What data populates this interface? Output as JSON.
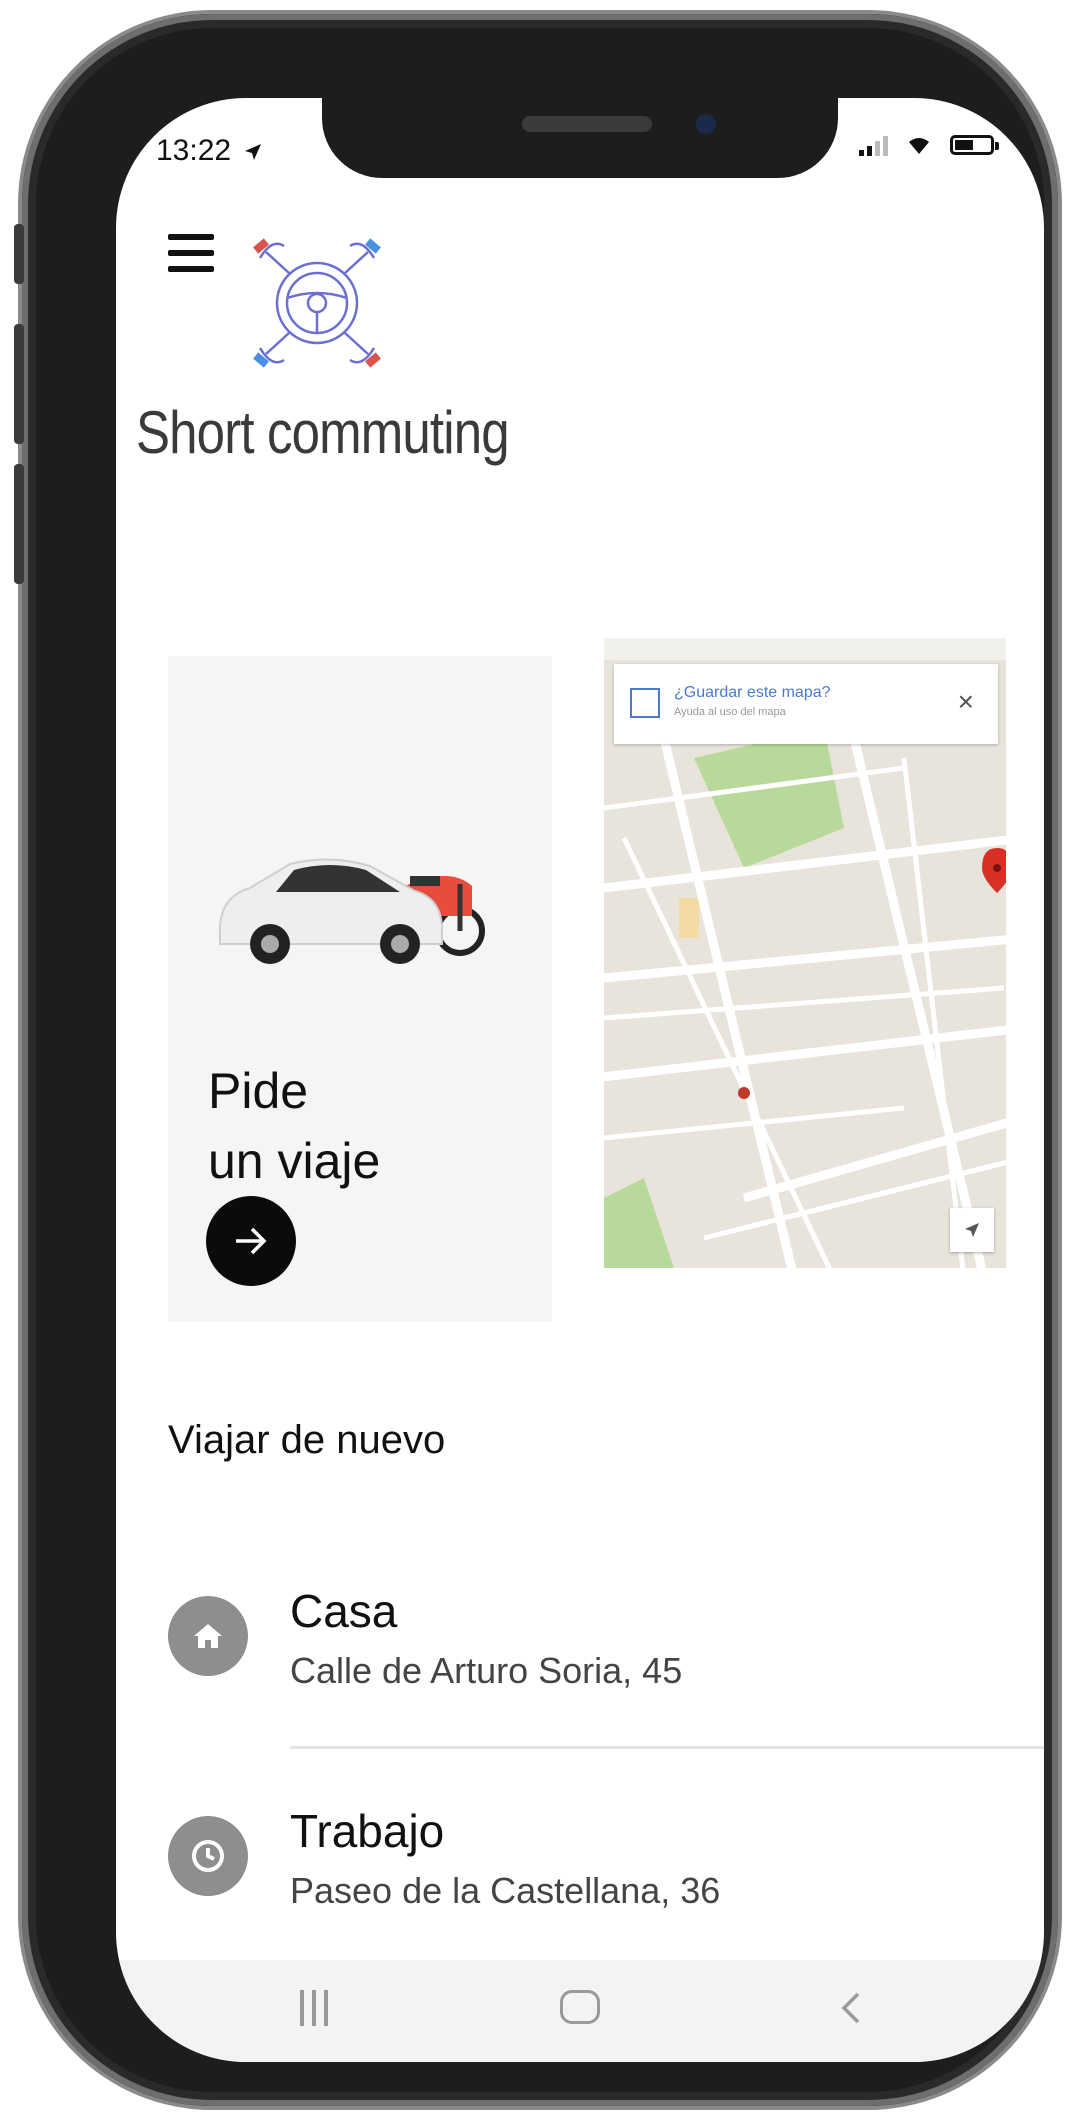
{
  "status_bar": {
    "time": "13:22",
    "location_icon": "location-arrow-icon",
    "signal_icon": "signal-icon",
    "wifi_icon": "wifi-icon",
    "battery_icon": "battery-icon"
  },
  "header": {
    "menu_icon": "hamburger-menu-icon",
    "logo_icon": "steering-wheel-drone-logo",
    "app_name": "Short commuting"
  },
  "cards": {
    "ride_card": {
      "title_line1": "Pide",
      "title_line2": "un viaje",
      "image": "car-and-scooter-image",
      "arrow_icon": "arrow-right-icon"
    },
    "map_card": {
      "banner_text": "¿Guardar este mapa?",
      "banner_sub": "Ayuda al uso del mapa",
      "close_icon": "close-icon",
      "pin_icon": "map-pin-icon",
      "locate_icon": "locate-icon"
    }
  },
  "section": {
    "title": "Viajar de nuevo"
  },
  "places": [
    {
      "name": "Casa",
      "address": "Calle de Arturo Soria, 45",
      "icon": "home-icon"
    },
    {
      "name": "Trabajo",
      "address": "Paseo de la Castellana, 36",
      "icon": "clock-icon"
    }
  ],
  "nav_bar": {
    "recent_icon": "recent-apps-icon",
    "home_icon": "home-button-icon",
    "back_icon": "back-chevron-icon"
  },
  "colors": {
    "accent": "#0b0b0b",
    "card_bg": "#f5f5f5",
    "icon_gray": "#8e8e8e",
    "map_pin": "#d93025",
    "logo_purple": "#6b6fcf"
  }
}
